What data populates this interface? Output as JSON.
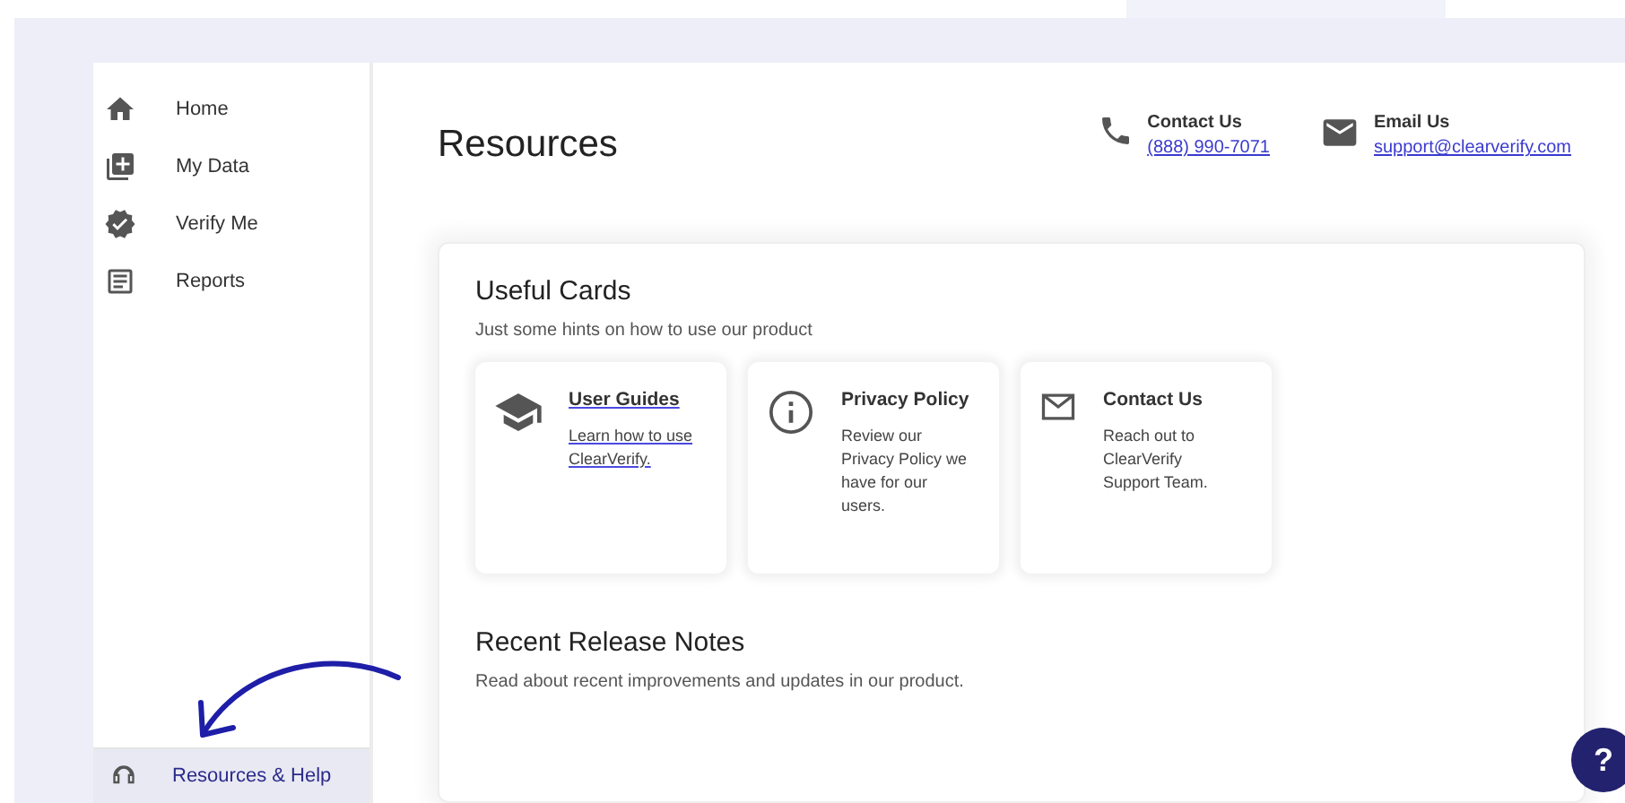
{
  "sidebar": {
    "items": [
      {
        "kind": "home",
        "label": "Home",
        "selected": false
      },
      {
        "kind": "data",
        "label": "My Data",
        "selected": false
      },
      {
        "kind": "verify",
        "label": "Verify Me",
        "selected": false
      },
      {
        "kind": "reports",
        "label": "Reports",
        "selected": false
      }
    ],
    "footer_item": {
      "kind": "help",
      "label": "Resources & Help",
      "selected": true
    }
  },
  "page_title": "Resources",
  "contacts": [
    {
      "kind": "phone",
      "title": "Contact Us",
      "link": "(888) 990-7071"
    },
    {
      "kind": "mail",
      "title": "Email Us",
      "link": "support@clearverify.com"
    }
  ],
  "useful_cards": {
    "title": "Useful Cards",
    "subtitle": "Just some hints on how to use our product",
    "cards": [
      {
        "kind": "guides",
        "title": "User Guides",
        "text": "Learn how to use ClearVerify.",
        "linked": true
      },
      {
        "kind": "info",
        "title": "Privacy Policy",
        "text": "Review our Privacy Policy we have for our users.",
        "linked": false
      },
      {
        "kind": "mail",
        "title": "Contact Us",
        "text": "Reach out to ClearVerify Support Team.",
        "linked": false
      }
    ]
  },
  "release_notes": {
    "title": "Recent Release Notes",
    "subtitle": "Read about recent improvements and updates in our product."
  },
  "help_button": {
    "label": "?"
  }
}
